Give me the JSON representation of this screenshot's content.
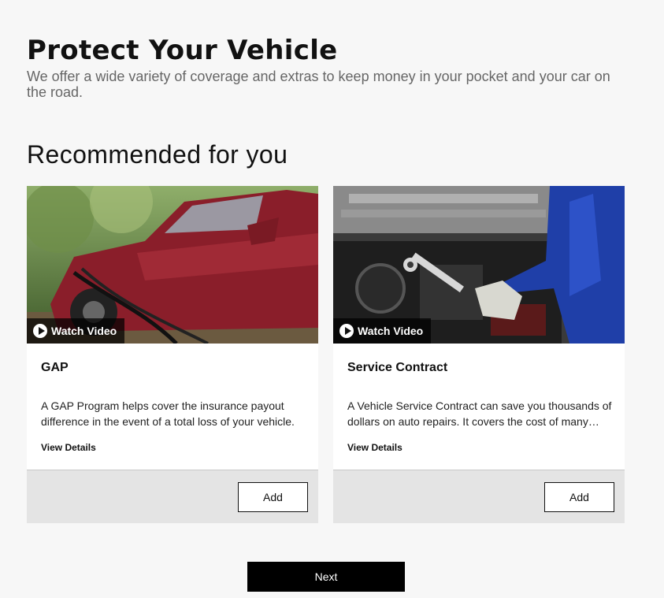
{
  "header": {
    "title": "Protect Your Vehicle",
    "subtitle": "We offer a wide variety of coverage and extras to keep money in your pocket and your car on the road."
  },
  "recommended": {
    "heading": "Recommended for you",
    "cards": [
      {
        "watch_label": "Watch Video",
        "title": "GAP",
        "description": "A GAP Program helps cover the insurance payout difference in the event of a total loss of your vehicle.",
        "details_label": "View Details",
        "add_label": "Add"
      },
      {
        "watch_label": "Watch Video",
        "title": "Service Contract",
        "description": "A Vehicle Service Contract can save you thousands of dollars on auto repairs. It covers the cost of many repairs.",
        "details_label": "View Details",
        "add_label": "Add"
      }
    ]
  },
  "footer": {
    "next_label": "Next"
  },
  "colors": {
    "accent": "#000000",
    "footer_bg": "#e4e4e4",
    "page_bg": "#f7f7f7"
  }
}
